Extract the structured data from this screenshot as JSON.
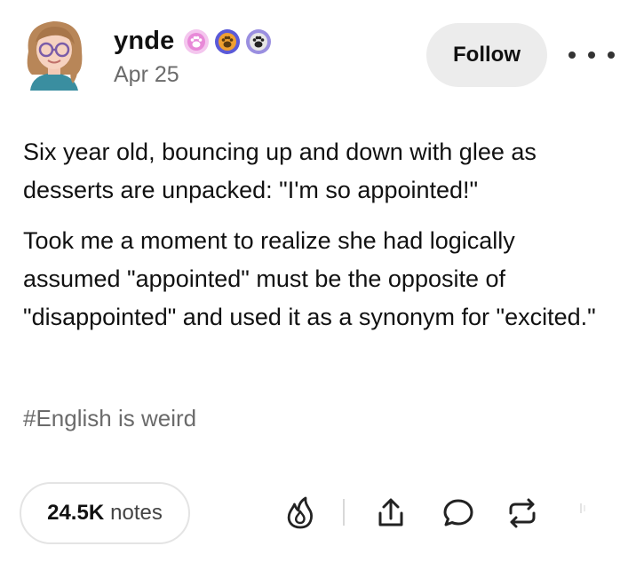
{
  "post": {
    "username": "ynde",
    "date": "Apr 25",
    "follow_label": "Follow",
    "paragraphs": [
      "Six year old, bouncing up and down with glee as desserts are unpacked: \"I'm so appointed!\"",
      "Took me a moment to realize she had logically assumed \"appointed\" must be the opposite of \"disappointed\" and used it as a synonym for \"excited.\""
    ],
    "tag": "#English is weird",
    "notes_count": "24.5K",
    "notes_label": "notes",
    "badges": [
      {
        "icon": "pink-paw-badge-icon",
        "color": "#e889d8"
      },
      {
        "icon": "orange-paw-badge-icon",
        "color": "#f0a030"
      },
      {
        "icon": "gray-paw-badge-icon",
        "color": "#9a8fe0"
      }
    ],
    "actions": [
      "fire-icon",
      "share-icon",
      "reply-icon",
      "reblog-icon"
    ],
    "colors": {
      "text": "#111111",
      "muted": "#6b6b6b",
      "follow_bg": "#ececec",
      "border": "#e4e4e4"
    }
  }
}
